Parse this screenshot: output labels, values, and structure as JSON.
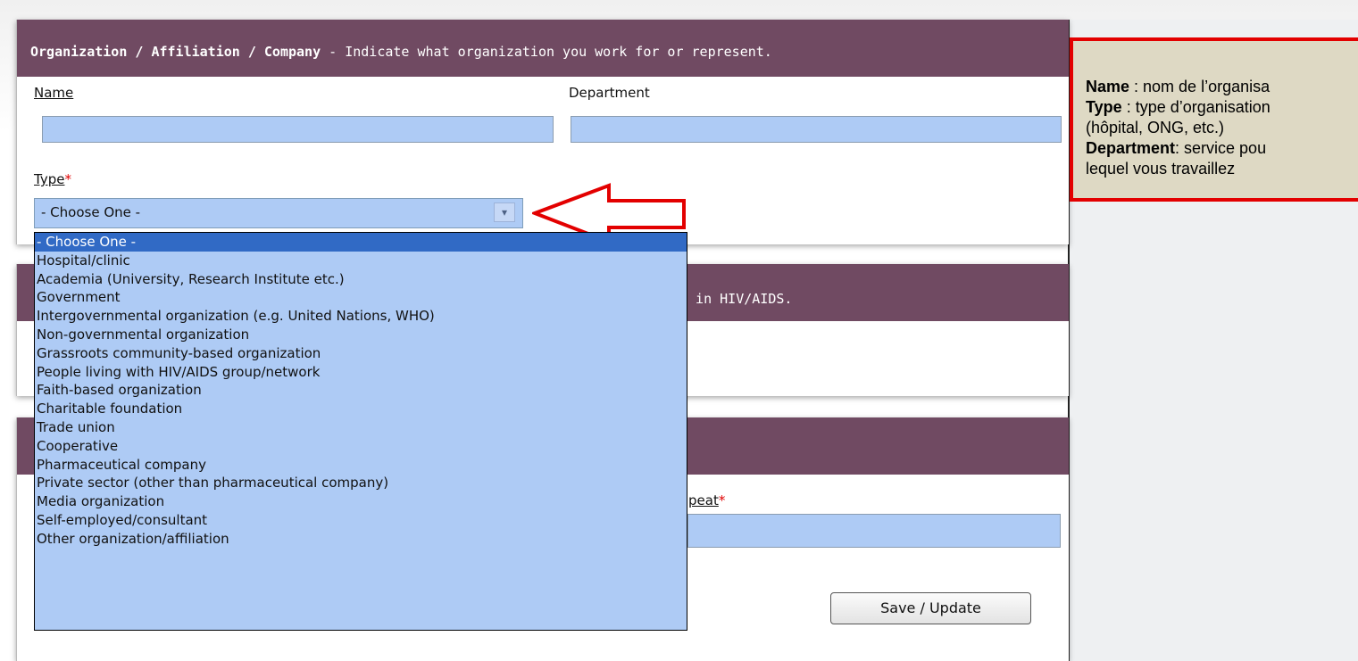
{
  "org_panel": {
    "heading_bold": "Organization / Affiliation / Company",
    "heading_rest": " - Indicate what organization you work for or represent.",
    "name_label": "Name",
    "department_label": "Department",
    "type_label": "Type",
    "required_mark": "*",
    "type_selected": "- Choose One -"
  },
  "type_options": [
    "- Choose One -",
    "Hospital/clinic",
    "Academia (University, Research Institute etc.)",
    "Government",
    "Intergovernmental organization (e.g. United Nations, WHO)",
    "Non-governmental organization",
    "Grassroots community-based organization",
    "People living with HIV/AIDS group/network",
    "Faith-based organization",
    "Charitable foundation",
    "Trade union",
    "Cooperative",
    "Pharmaceutical company",
    "Private sector (other than pharmaceutical company)",
    "Media organization",
    "Self-employed/consultant",
    "Other organization/affiliation"
  ],
  "second_panel": {
    "heading_fragment": "k in HIV/AIDS."
  },
  "third_panel": {
    "repeat_label_fragment": "peat",
    "save_button": "Save / Update"
  },
  "tooltip": {
    "line1_bold": "Name",
    "line1_rest": " : nom de l’organisa",
    "line2_bold": "Type",
    "line2_rest": " : type d’organisation",
    "line3": "(hôpital, ONG, etc.)",
    "line4_bold": "Department",
    "line4_rest": ": service pou",
    "line5": "lequel vous travaillez"
  },
  "colors": {
    "panel_header": "#704a62",
    "input_fill": "#aecbf5",
    "selected_option": "#316ac5",
    "callout_border": "#e30000"
  }
}
